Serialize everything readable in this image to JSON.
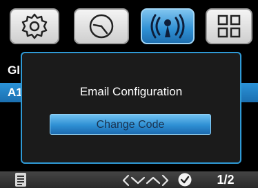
{
  "tabs": [
    {
      "icon": "gear-icon",
      "active": false
    },
    {
      "icon": "clock-icon",
      "active": false
    },
    {
      "icon": "wireless-icon",
      "active": true
    },
    {
      "icon": "grid-icon",
      "active": false
    }
  ],
  "menu": {
    "rows": [
      {
        "label": "Gl",
        "selected": false
      },
      {
        "label": "A1",
        "selected": true
      }
    ]
  },
  "dialog": {
    "title": "Email Configuration",
    "button_label": "Change Code"
  },
  "bottom_bar": {
    "page_indicator": "1/2",
    "icons": [
      "document-icon",
      "left-arrow-icon",
      "down-arrow-icon",
      "up-arrow-icon",
      "right-arrow-icon",
      "check-icon"
    ]
  },
  "colors": {
    "accent": "#2e8fd3",
    "dialog_border": "#2f9ad6",
    "background": "#000000"
  }
}
